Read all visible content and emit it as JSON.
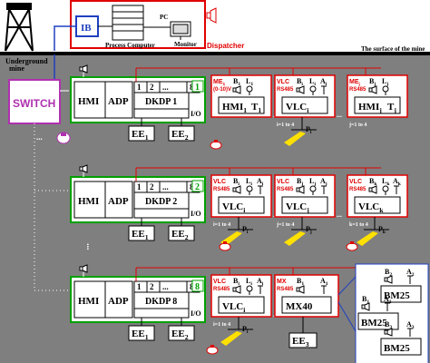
{
  "colors": {
    "mine_band": "#7f7f7f",
    "dispatcher_red": "#e00000",
    "green_box": "#00a000",
    "switch_purple": "#b030b0",
    "light_yellow": "#ffe000",
    "ib_blue": "#2040c0"
  },
  "surface": {
    "ib_label": "IB",
    "process_computer_label": "Process Computer",
    "pc_label": "PC",
    "monitor_label": "Monitor",
    "dispatcher_label": "Dispatcher",
    "surface_caption": "The surface of the mine",
    "underground_caption_1": "Underground",
    "underground_caption_2": "mine"
  },
  "switch_label": "SWITCH",
  "units": [
    {
      "hmi": "HMI",
      "adp": "ADP",
      "ports": [
        "1",
        "2",
        "...",
        "8"
      ],
      "dkdp": "DKDP 1",
      "io": "I/O",
      "number": "1",
      "ee_a": "EE",
      "ee_a_sub": "1",
      "ee_b": "EE",
      "ee_b_sub": "2",
      "devices": [
        {
          "tag": "ME",
          "tag_sub": "1",
          "bus": "(0-10)V",
          "top": "B",
          "top_sub": "1",
          "top2": "L",
          "top2_sub": "1",
          "top3": "",
          "top3_sub": "",
          "main": "HMI",
          "main_sub": "1",
          "second": "T",
          "second_sub": "1",
          "note": ""
        },
        {
          "tag": "VLC",
          "tag_sub": "",
          "bus": "RS485",
          "top": "B",
          "top_sub": "i",
          "top2": "L",
          "top2_sub": "i",
          "top3": "A",
          "top3_sub": "i",
          "main": "VLC",
          "main_sub": "i",
          "second": "",
          "second_sub": "",
          "note": "i=1 to 4",
          "pulse": "P",
          "pulse_sub": "i"
        },
        {
          "tag": "ME",
          "tag_sub": "j",
          "bus": "RS485",
          "top": "B",
          "top_sub": "j",
          "top2": "L",
          "top2_sub": "j",
          "top3": "",
          "top3_sub": "",
          "main": "HMI",
          "main_sub": "j",
          "second": "T",
          "second_sub": "j",
          "note": "j=1 to 4"
        }
      ]
    },
    {
      "hmi": "HMI",
      "adp": "ADP",
      "ports": [
        "1",
        "2",
        "...",
        "8"
      ],
      "dkdp": "DKDP 2",
      "io": "I/O",
      "number": "2",
      "ee_a": "EE",
      "ee_a_sub": "1",
      "ee_b": "EE",
      "ee_b_sub": "2",
      "devices": [
        {
          "tag": "VLC",
          "bus": "RS485",
          "top": "B",
          "top_sub": "i",
          "top2": "L",
          "top2_sub": "i",
          "top3": "A",
          "top3_sub": "i",
          "main": "VLC",
          "main_sub": "i",
          "note": "i=1 to 4",
          "pulse": "P",
          "pulse_sub": "i"
        },
        {
          "tag": "VLC",
          "bus": "RS485",
          "top": "B",
          "top_sub": "j",
          "top2": "L",
          "top2_sub": "j",
          "top3": "A",
          "top3_sub": "j",
          "main": "VLC",
          "main_sub": "j",
          "note": "j=1 to 4",
          "pulse": "P",
          "pulse_sub": "j"
        },
        {
          "tag": "VLC",
          "bus": "RS485",
          "top": "B",
          "top_sub": "k",
          "top2": "L",
          "top2_sub": "k",
          "top3": "A",
          "top3_sub": "k",
          "main": "VLC",
          "main_sub": "k",
          "note": "k=1 to 4",
          "pulse": "P",
          "pulse_sub": "k"
        }
      ]
    },
    {
      "hmi": "HMI",
      "adp": "ADP",
      "ports": [
        "1",
        "2",
        "...",
        "8"
      ],
      "dkdp": "DKDP 8",
      "io": "I/O",
      "number": "8",
      "ee_a": "EE",
      "ee_a_sub": "1",
      "ee_b": "EE",
      "ee_b_sub": "2",
      "devices": [
        {
          "tag": "VLC",
          "bus": "RS485",
          "top": "B",
          "top_sub": "i",
          "top2": "L",
          "top2_sub": "i",
          "top3": "A",
          "top3_sub": "i",
          "main": "VLC",
          "main_sub": "i",
          "note": "i=1 to 4",
          "pulse": "P",
          "pulse_sub": "i"
        },
        {
          "tag": "MX",
          "bus": "RS485",
          "top": "B",
          "top_sub": "1",
          "top2": "",
          "top2_sub": "",
          "top3": "A",
          "top3_sub": "1",
          "main": "MX40",
          "main_sub": "",
          "note": ""
        }
      ],
      "ee3": "EE",
      "ee3_sub": "3",
      "bm": [
        {
          "top": "B",
          "top_sub": "2",
          "top2": "A",
          "top2_sub": "2",
          "main": "BM25"
        },
        {
          "top": "B",
          "top_sub": "1",
          "top2": "A",
          "top2_sub": "1",
          "main": "BM25"
        },
        {
          "top": "B",
          "top_sub": "3",
          "top2": "A",
          "top2_sub": "3",
          "main": "BM25"
        }
      ]
    }
  ],
  "dots": "..."
}
